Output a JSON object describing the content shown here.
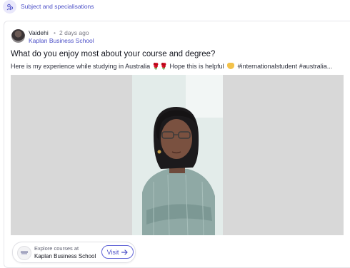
{
  "topic": {
    "label": "Subject and specialisations",
    "icon": "people-icon"
  },
  "post": {
    "author": "Vaidehi",
    "separator": "•",
    "time": "2 days ago",
    "school": "Kaplan Business School",
    "title": "What do you enjoy most about your course and degree?",
    "body_part1": "Here is my experience while studying in Australia",
    "emoji_roses": "🌹🌹",
    "body_part2": "Hope this is helpful",
    "body_part3": "#internationalstudent #australia..."
  },
  "cta": {
    "explore_label": "Explore courses at",
    "school_name": "Kaplan Business School",
    "visit_label": "Visit",
    "visit_icon": "arrow-right-icon"
  },
  "colors": {
    "accent": "#4b4fc7",
    "media_bg": "#d8d8d8"
  }
}
